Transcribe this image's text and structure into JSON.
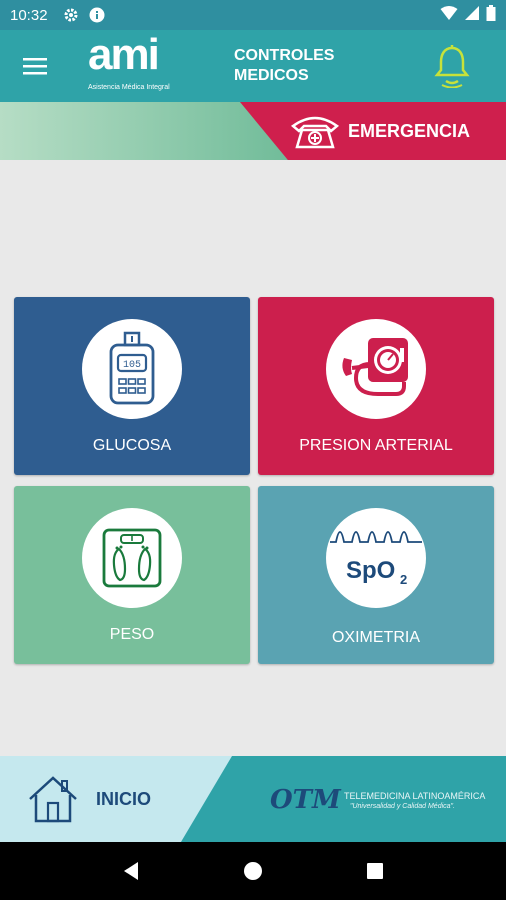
{
  "status_bar": {
    "time": "10:32",
    "icons": [
      "settings-icon",
      "info-icon",
      "wifi-icon",
      "signal-icon",
      "battery-icon"
    ]
  },
  "app_bar": {
    "logo_text": "ami",
    "logo_tagline": "Asistencia Médica Integral",
    "title_line1": "CONTROLES",
    "title_line2": "MEDICOS",
    "icons": [
      "menu-icon",
      "bell-icon"
    ]
  },
  "emergency": {
    "label": "EMERGENCIA",
    "icon": "phone-icon"
  },
  "cards": [
    {
      "label": "GLUCOSA",
      "icon": "glucometer-icon",
      "color": "#2f5d90"
    },
    {
      "label": "PRESION ARTERIAL",
      "icon": "blood-pressure-icon",
      "color": "#cc1f4d"
    },
    {
      "label": "PESO",
      "icon": "scale-icon",
      "color": "#78bf9b"
    },
    {
      "label": "OXIMETRIA",
      "icon": "spo2-icon",
      "color": "#5aa3b2"
    }
  ],
  "glucometer_reading": "105",
  "spo2": {
    "main": "SpO",
    "sub": "2"
  },
  "bottom_bar": {
    "home_label": "INICIO",
    "brand_mark": "OTM",
    "brand_name": "TELEMEDICINA LATINOAMÉRICA",
    "brand_slogan": "\"Universalidad y Calidad Médica\"."
  },
  "colors": {
    "teal": "#2fa3a8",
    "emergency_red": "#cf1f4d",
    "navy": "#1d4a7a"
  }
}
